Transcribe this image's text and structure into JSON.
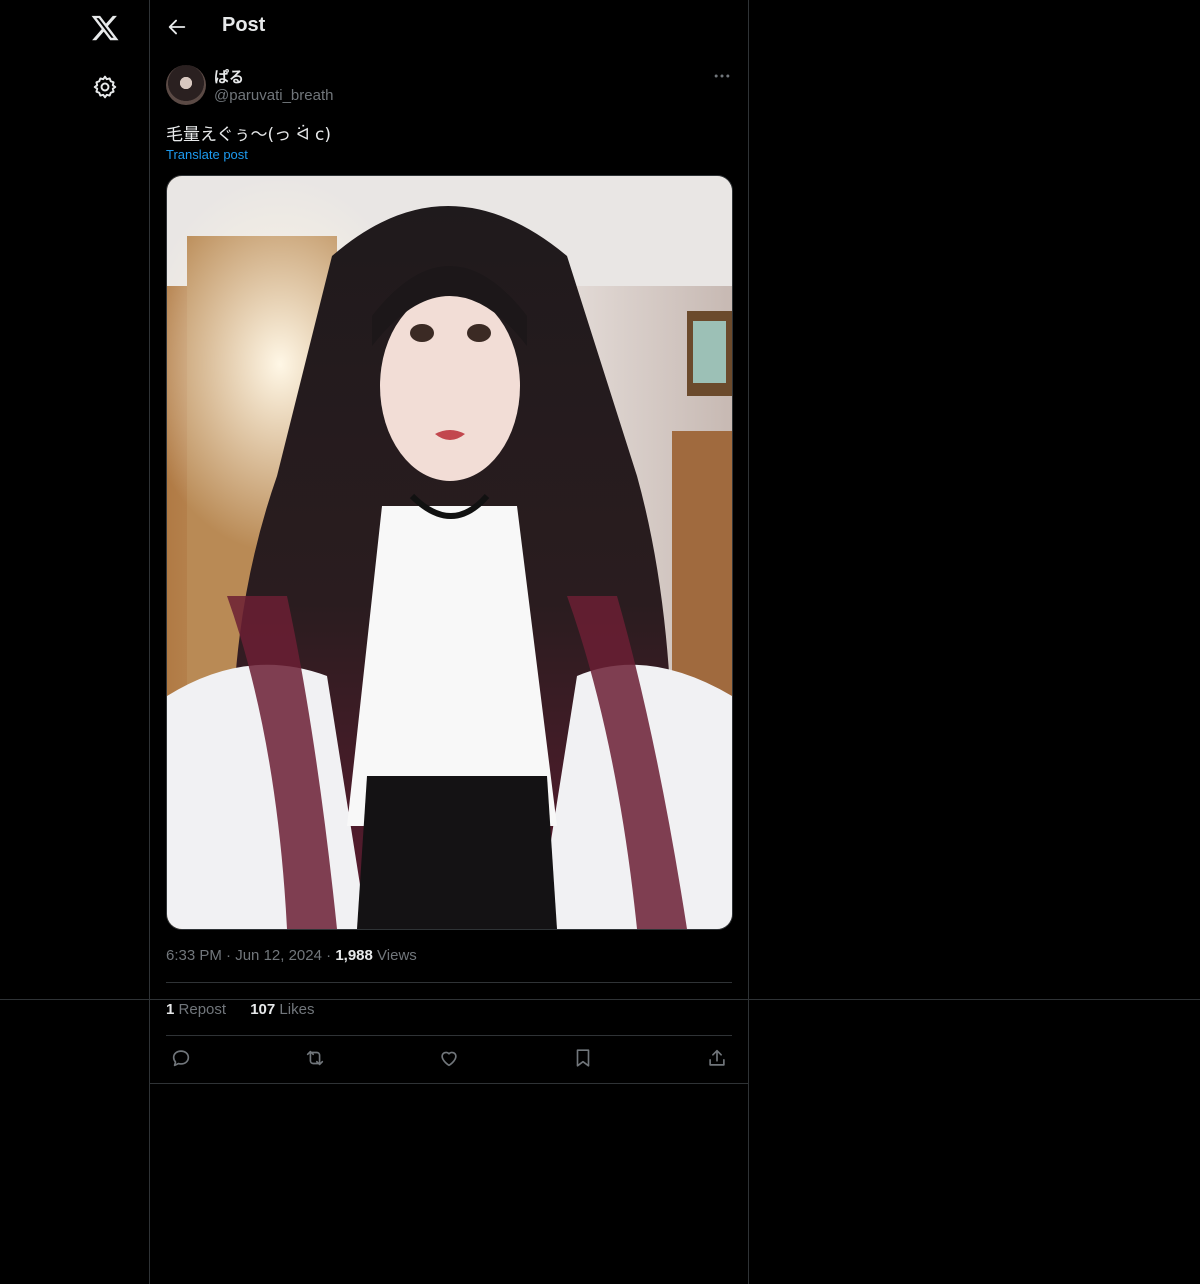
{
  "header": {
    "title": "Post"
  },
  "author": {
    "display_name": "ぱる",
    "handle": "@paruvati_breath"
  },
  "post": {
    "text": "毛量えぐぅ〜(っ ᐛ c)",
    "translate_label": "Translate post"
  },
  "meta": {
    "time": "6:33 PM",
    "sep1": " · ",
    "date": "Jun 12, 2024",
    "sep2": " · ",
    "views_count": "1,988",
    "views_label": "Views"
  },
  "stats": {
    "reposts_count": "1",
    "reposts_label": "Repost",
    "likes_count": "107",
    "likes_label": "Likes"
  },
  "icons": [
    "x-logo-icon",
    "gear-icon",
    "back-arrow-icon",
    "more-icon",
    "reply-icon",
    "repost-icon",
    "like-icon",
    "bookmark-icon",
    "share-icon"
  ],
  "colors": {
    "background": "#000000",
    "text": "#e7e9ea",
    "muted": "#71767b",
    "link": "#1d9bf0",
    "border": "#2f3336"
  }
}
